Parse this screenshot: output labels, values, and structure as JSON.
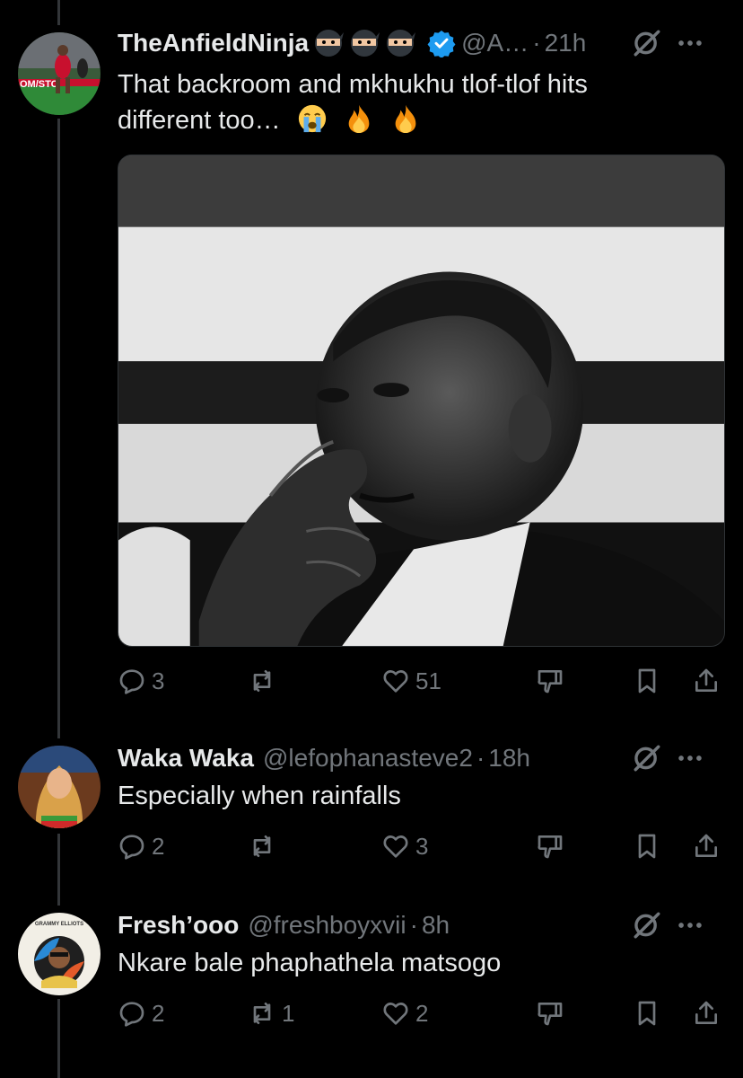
{
  "tweets": [
    {
      "name": "TheAnfieldNinja",
      "handle": "@A…",
      "separator": "·",
      "time": "21h",
      "text_line1": "That backroom and mkhukhu tlof-tlof hits",
      "text_line2": "different too…",
      "verified": true,
      "name_emojis": [
        "ninja",
        "ninja",
        "ninja"
      ],
      "text_emojis": [
        "loudly-crying-face",
        "fire",
        "fire"
      ],
      "avatar_text": "OM/STO",
      "actions": {
        "replies": "3",
        "reposts": "",
        "likes": "51"
      }
    },
    {
      "name": "Waka Waka",
      "handle": "@lefophanasteve2",
      "separator": "·",
      "time": "18h",
      "text_line1": "Especially when rainfalls",
      "actions": {
        "replies": "2",
        "reposts": "",
        "likes": "3"
      }
    },
    {
      "name": "Fresh’ooo",
      "handle": "@freshboyxvii",
      "separator": "·",
      "time": "8h",
      "text_line1": "Nkare bale phaphathela matsogo",
      "avatar_text": "GRAMMY ELLIOTS",
      "actions": {
        "replies": "2",
        "reposts": "1",
        "likes": "2"
      }
    }
  ],
  "colors": {
    "background": "#000000",
    "text": "#e7e9ea",
    "muted": "#71767b",
    "verified": "#1d9bf0",
    "thread_line": "#333639"
  }
}
